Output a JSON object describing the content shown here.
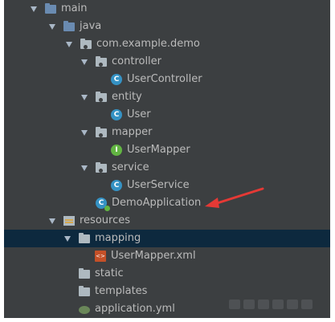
{
  "tree": {
    "main": "main",
    "java": "java",
    "package": "com.example.demo",
    "controller": "controller",
    "user_controller": "UserController",
    "entity": "entity",
    "user": "User",
    "mapper": "mapper",
    "user_mapper": "UserMapper",
    "service": "service",
    "user_service": "UserService",
    "demo_application": "DemoApplication",
    "resources": "resources",
    "mapping": "mapping",
    "user_mapper_xml": "UserMapper.xml",
    "static": "static",
    "templates": "templates",
    "application_yml": "application.yml"
  },
  "icons": {
    "class_badge": "C",
    "interface_badge": "I",
    "xml_badge": "<>"
  },
  "colors": {
    "panel_bg": "#3c3f41",
    "selection_bg": "#0d293e",
    "text": "#bbbbbb",
    "annotation_arrow": "#e53935"
  }
}
